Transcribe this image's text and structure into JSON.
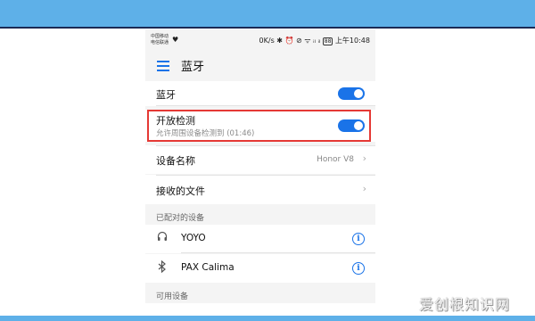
{
  "status_bar": {
    "carrier_line1": "中国移动",
    "carrier_line2": "电信联通",
    "heart_icon": "heart-icon",
    "speed": "0K/s",
    "icons_text": "✱ ⏰ ⊘ ᯤ ᵢₗ ᵢₗ",
    "battery": "88",
    "time": "上午10:48"
  },
  "appbar": {
    "title": "蓝牙"
  },
  "settings": {
    "bluetooth_label": "蓝牙",
    "bluetooth_on": true,
    "discover_label": "开放检测",
    "discover_sub": "允许周围设备检测到 (01:46)",
    "discover_on": true,
    "device_name_label": "设备名称",
    "device_name_value": "Honor V8",
    "received_files_label": "接收的文件"
  },
  "paired": {
    "section_title": "已配对的设备",
    "devices": [
      {
        "name": "YOYO",
        "icon": "headphones-icon"
      },
      {
        "name": "PAX Calima",
        "icon": "bluetooth-icon"
      }
    ]
  },
  "available": {
    "section_title": "可用设备"
  },
  "watermark": "爱创根知识网",
  "colors": {
    "accent": "#1a73e8",
    "highlight": "#e53935",
    "band": "#5eb0e8"
  }
}
